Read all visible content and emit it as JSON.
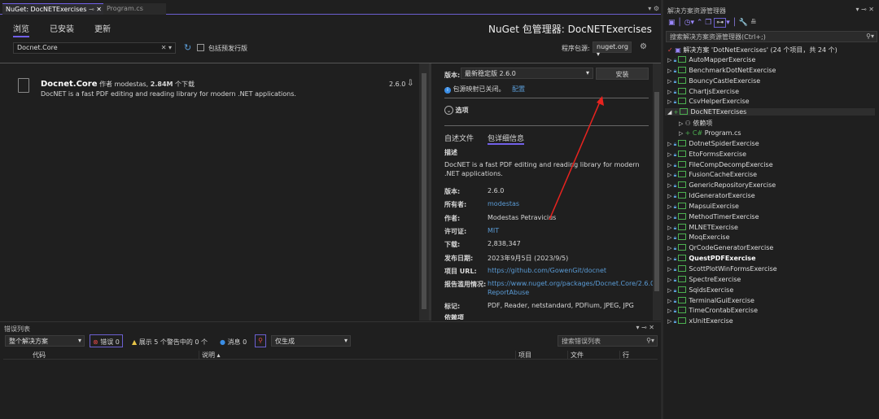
{
  "tabs": [
    {
      "label": "NuGet: DocNETExercises"
    },
    {
      "label": "Program.cs"
    }
  ],
  "nuget": {
    "title": "NuGet 包管理器: DocNETExercises",
    "nav": [
      "浏览",
      "已安装",
      "更新"
    ],
    "search_value": "Docnet.Core",
    "prerelease_label": "包括预发行版",
    "source_label": "程序包源:",
    "source_value": "nuget.org",
    "package": {
      "name": "Docnet.Core",
      "by": "作者 modestas,",
      "downloads": "2.84M",
      "downloads_suffix": "个下载",
      "description": "DocNET is a fast PDF editing and reading library for modern .NET applications.",
      "version": "2.6.0"
    },
    "detail": {
      "version_label": "版本:",
      "version_select": "最新稳定版 2.6.0",
      "install_button": "安装",
      "info_text": "包源映射已关闭。",
      "configure_link": "配置",
      "options_label": "选项",
      "subtabs": [
        "自述文件",
        "包详细信息"
      ],
      "desc_heading": "描述",
      "desc": "DocNET is a fast PDF editing and reading library for modern .NET applications.",
      "fields": [
        {
          "k": "版本:",
          "v": "2.6.0",
          "link": false
        },
        {
          "k": "所有者:",
          "v": "modestas",
          "link": true
        },
        {
          "k": "作者:",
          "v": "Modestas Petravicius",
          "link": false
        },
        {
          "k": "许可证:",
          "v": "MIT",
          "link": true
        },
        {
          "k": "下载:",
          "v": "2,838,347",
          "link": false
        },
        {
          "k": "发布日期:",
          "v": "2023年9月5日 (2023/9/5)",
          "link": false
        },
        {
          "k": "项目 URL:",
          "v": "https://github.com/GowenGit/docnet",
          "link": true
        },
        {
          "k": "报告滥用情况:",
          "v": "https://www.nuget.org/packages/Docnet.Core/2.6.0/",
          "v2": "ReportAbuse",
          "link": true
        },
        {
          "k": "标记:",
          "v": "PDF, Reader, netstandard, PDFium, JPEG, JPG",
          "link": false
        }
      ],
      "deps_heading": "依赖项"
    }
  },
  "errors": {
    "title": "错误列表",
    "scope": "整个解决方案",
    "errors": "错误 0",
    "warnings": "展示 5 个警告中的 0 个",
    "messages": "消息 0",
    "build_filter": "仅生成",
    "search_placeholder": "搜索错误列表",
    "columns": [
      "代码",
      "说明",
      "项目",
      "文件",
      "行"
    ]
  },
  "solution": {
    "title": "解决方案资源管理器",
    "search_placeholder": "搜索解决方案资源管理器(Ctrl+;)",
    "root": "解决方案 'DotNetExercises' (24 个项目，共 24 个)",
    "items": [
      {
        "label": "AutoMapperExercise"
      },
      {
        "label": "BenchmarkDotNetExercise"
      },
      {
        "label": "BouncyCastleExercise"
      },
      {
        "label": "ChartjsExercise"
      },
      {
        "label": "CsvHelperExercise"
      },
      {
        "label": "DocNETExercises",
        "expanded": true
      },
      {
        "label": "依赖项",
        "child": true
      },
      {
        "label": "Program.cs",
        "child": true
      },
      {
        "label": "DotnetSpiderExercise"
      },
      {
        "label": "EtoFormsExercise"
      },
      {
        "label": "FileCompDecompExercise"
      },
      {
        "label": "FusionCacheExercise"
      },
      {
        "label": "GenericRepositoryExercise"
      },
      {
        "label": "IdGeneratorExercise"
      },
      {
        "label": "MapsuiExercise"
      },
      {
        "label": "MethodTimerExercise"
      },
      {
        "label": "MLNETExercise"
      },
      {
        "label": "MoqExercise"
      },
      {
        "label": "QrCodeGeneratorExercise"
      },
      {
        "label": "QuestPDFExercise",
        "bold": true
      },
      {
        "label": "ScottPlotWinFormsExercise"
      },
      {
        "label": "SpectreExercise"
      },
      {
        "label": "SqidsExercise"
      },
      {
        "label": "TerminalGuiExercise"
      },
      {
        "label": "TimeCrontabExercise"
      },
      {
        "label": "xUnitExercise"
      }
    ]
  }
}
